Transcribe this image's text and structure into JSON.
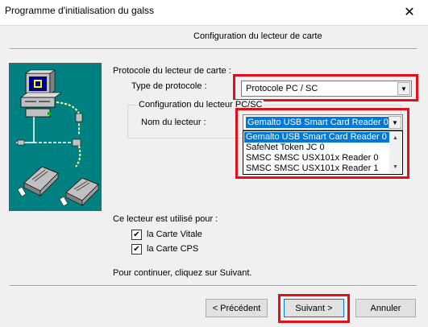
{
  "window": {
    "title": "Programme d'initialisation du galss",
    "close_glyph": "✕"
  },
  "header": {
    "subtitle": "Configuration du lecteur de carte"
  },
  "protocol": {
    "section_label": "Protocole du lecteur de carte :",
    "type_label": "Type de protocole :",
    "type_value": "Protocole PC / SC"
  },
  "reader": {
    "group_label": "Configuration du lecteur PC/SC",
    "name_label": "Nom du lecteur :",
    "name_value": "Gemalto USB Smart Card Reader 0",
    "options": [
      "Gemalto USB Smart Card Reader 0",
      "SafeNet Token JC 0",
      "SMSC SMSC USX101x Reader  0",
      "SMSC SMSC USX101x Reader  1"
    ],
    "selected_index": 0
  },
  "usage": {
    "label": "Ce lecteur est utilisé pour :",
    "vitale_label": "la Carte Vitale",
    "cps_label": "la Carte CPS",
    "vitale_checked": true,
    "cps_checked": true,
    "check_glyph": "✔"
  },
  "instruction": "Pour continuer, cliquez sur Suivant.",
  "buttons": {
    "previous": "< Précédent",
    "next": "Suivant >",
    "cancel": "Annuler"
  },
  "colors": {
    "highlight": "#e3101c",
    "selection": "#0078d7",
    "illustration_bg": "#008080"
  },
  "icons": {
    "dropdown": "chevron-down-icon",
    "illustration": "computer-card-reader-icon"
  }
}
